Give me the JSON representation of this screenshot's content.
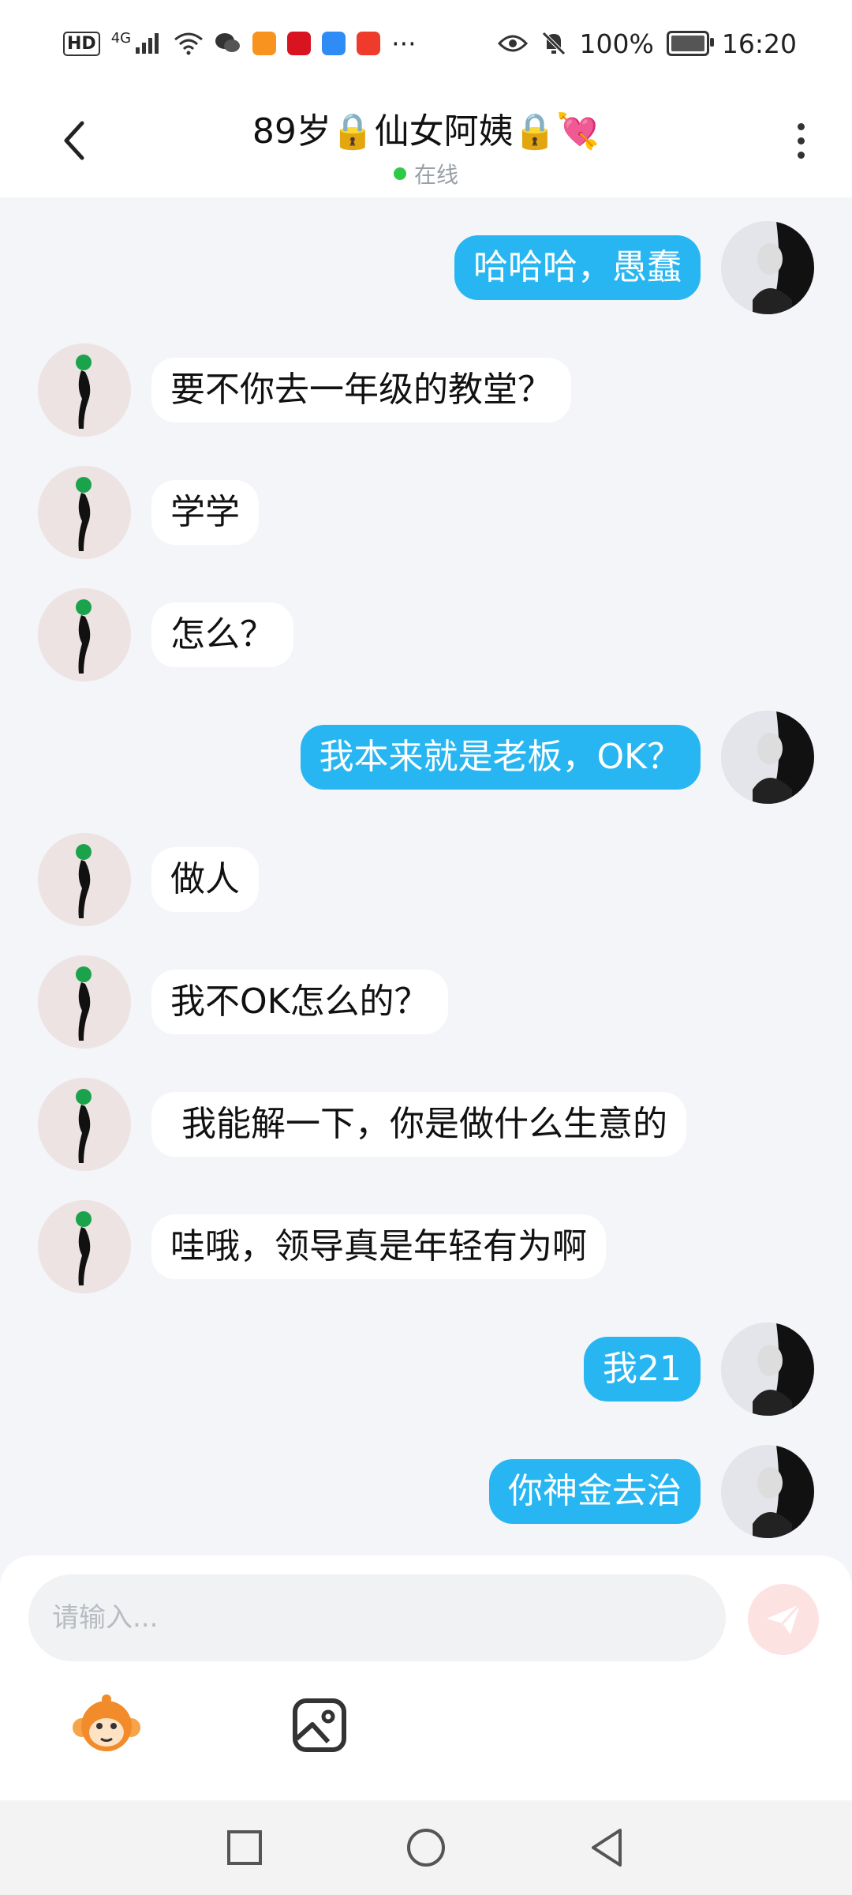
{
  "status_bar": {
    "left_label": "HD",
    "network": "4G",
    "more": "···",
    "battery": "100%",
    "time": "16:20",
    "icons": [
      "hd-icon",
      "signal-icon",
      "wifi-icon",
      "wechat-icon",
      "video-app-icon",
      "heart-app-icon",
      "cloud-app-icon",
      "gift-app-icon",
      "eye-icon",
      "mute-icon",
      "battery-icon"
    ]
  },
  "header": {
    "title": "89岁🔒仙女阿姨🔒💘",
    "status": "在线",
    "status_color": "#2fc94a"
  },
  "messages": [
    {
      "side": "out",
      "text": "哈哈哈，愚蠢"
    },
    {
      "side": "in",
      "text": "要不你去一年级的教堂？"
    },
    {
      "side": "in",
      "text": "学学"
    },
    {
      "side": "in",
      "text": "怎么？"
    },
    {
      "side": "out",
      "text": "我本来就是老板，OK？"
    },
    {
      "side": "in",
      "text": "做人"
    },
    {
      "side": "in",
      "text": "我不OK怎么的？"
    },
    {
      "side": "in",
      "text": " 我能解一下，你是做什么生意的"
    },
    {
      "side": "in",
      "text": "哇哦，领导真是年轻有为啊"
    },
    {
      "side": "out",
      "text": "我21"
    },
    {
      "side": "out",
      "text": "你神金去治"
    }
  ],
  "composer": {
    "placeholder": "请输入...",
    "send_color": "#fde2e2",
    "tools": [
      "emoji-monkey-icon",
      "image-icon"
    ]
  },
  "colors": {
    "outgoing_bubble": "#27b6f2",
    "incoming_bubble": "#ffffff",
    "background": "#f3f5f8"
  }
}
